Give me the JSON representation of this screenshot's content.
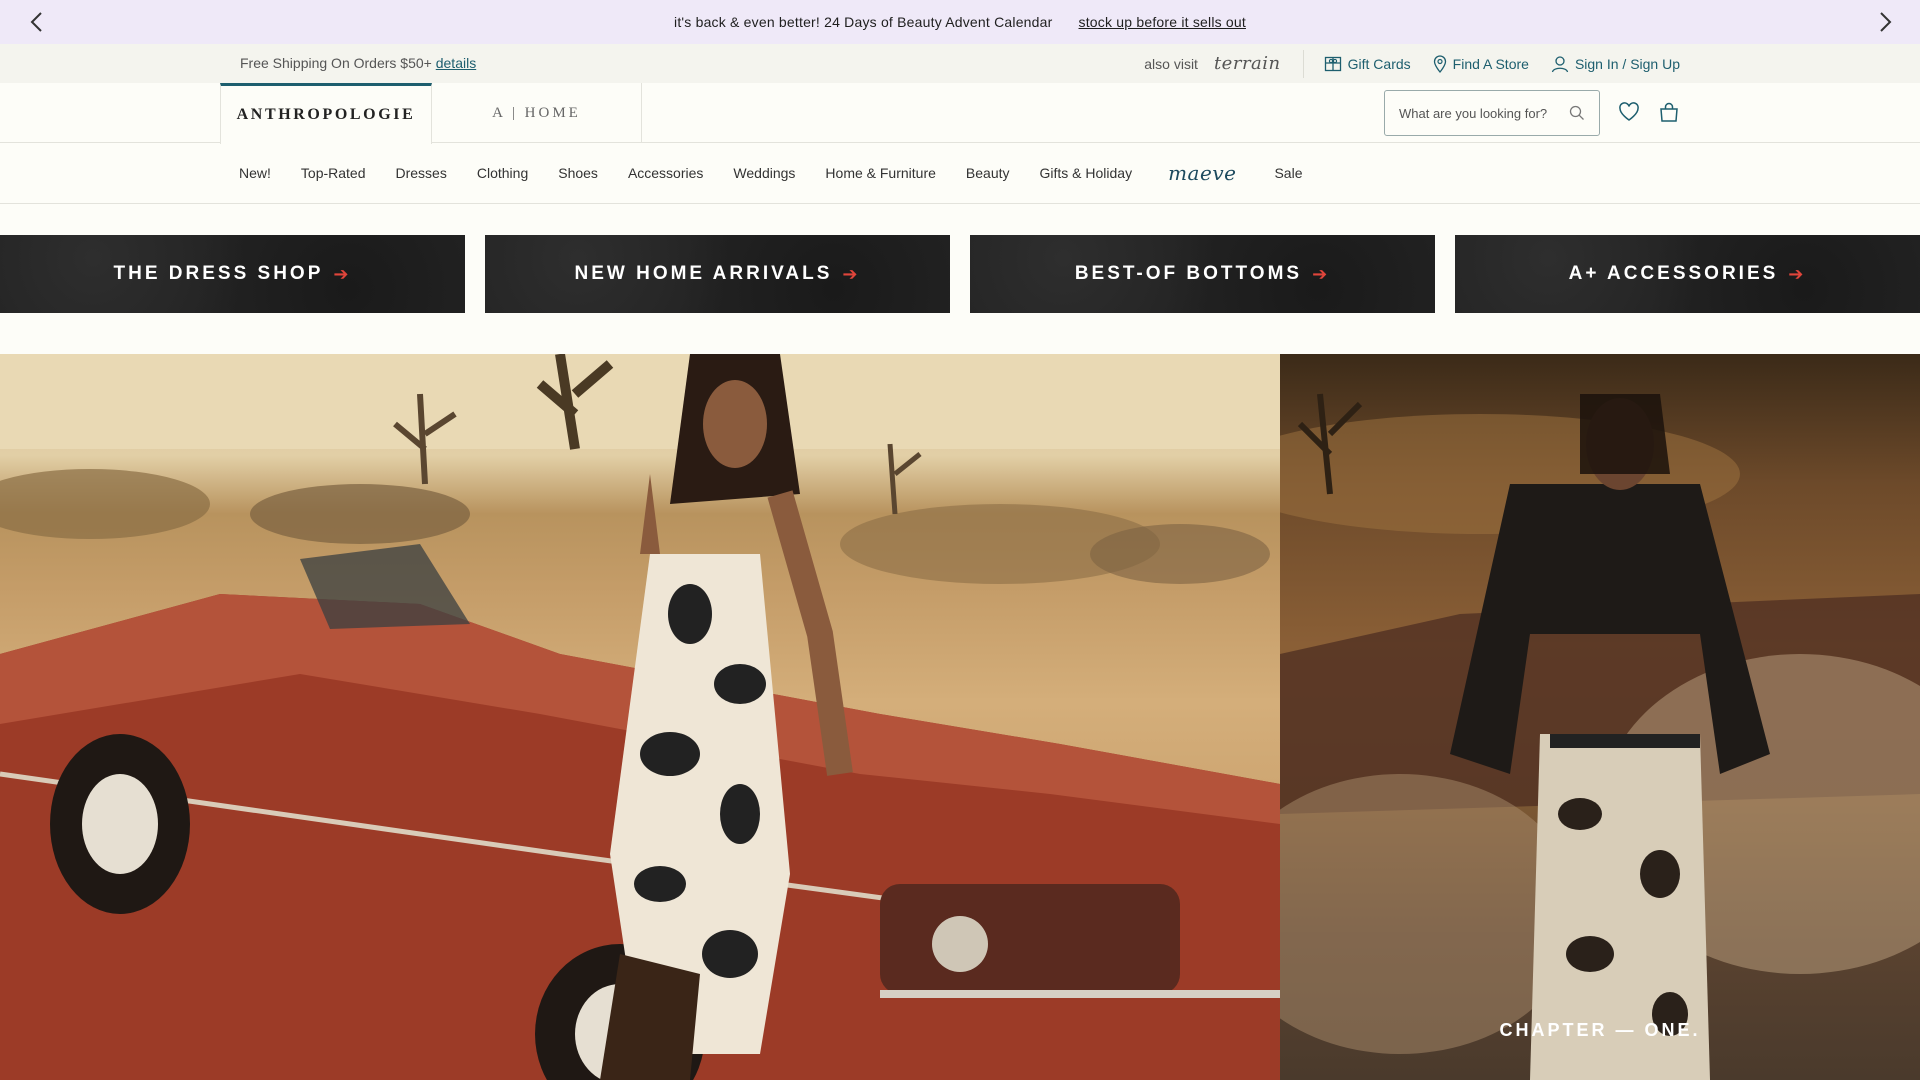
{
  "promo": {
    "message": "it's back & even better! 24 Days of Beauty Advent Calendar",
    "cta": "stock up before it sells out"
  },
  "utility": {
    "shipping_text": "Free Shipping On Orders $50+",
    "details_link": "details",
    "also_visit": "also visit",
    "terrain": "terrain",
    "gift_cards": "Gift Cards",
    "find_store": "Find A Store",
    "sign_in": "Sign In / Sign Up"
  },
  "brand_tabs": {
    "anthropologie": "ANTHROPOLOGIE",
    "home": "A | HOME"
  },
  "search": {
    "placeholder": "What are you looking for?"
  },
  "nav": {
    "items": [
      "New!",
      "Top-Rated",
      "Dresses",
      "Clothing",
      "Shoes",
      "Accessories",
      "Weddings",
      "Home & Furniture",
      "Beauty",
      "Gifts & Holiday",
      "maeve",
      "Sale"
    ]
  },
  "banners": [
    {
      "label": "THE DRESS SHOP"
    },
    {
      "label": "NEW HOME ARRIVALS"
    },
    {
      "label": "BEST-OF BOTTOMS"
    },
    {
      "label": "A+ ACCESSORIES"
    }
  ],
  "hero": {
    "chapter": "CHAPTER — ONE."
  },
  "colors": {
    "accent": "#1d5e6e",
    "promo_bg": "#efe9f8",
    "banner_arrow": "#e0453b"
  }
}
